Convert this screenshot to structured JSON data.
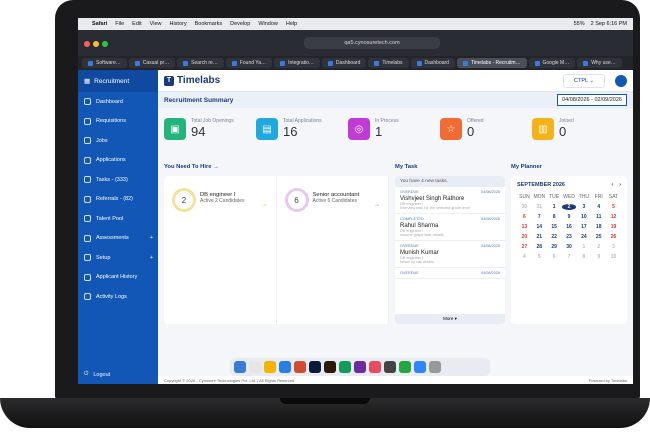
{
  "menubar": {
    "apple": "",
    "app": "Safari",
    "items": [
      "File",
      "Edit",
      "View",
      "History",
      "Bookmarks",
      "Develop",
      "Window",
      "Help"
    ],
    "right": [
      "55%",
      "2 Sep 6:16 PM"
    ]
  },
  "browser": {
    "url": "qa5.cynosuretech.com",
    "tabs": [
      {
        "label": "Software…",
        "active": false
      },
      {
        "label": "Casual pr…",
        "active": false
      },
      {
        "label": "Search re…",
        "active": false
      },
      {
        "label": "Found Ya…",
        "active": false
      },
      {
        "label": "Integratio…",
        "active": false
      },
      {
        "label": "Dashboard",
        "active": false
      },
      {
        "label": "Timelabs",
        "active": false
      },
      {
        "label": "Dashboard",
        "active": false
      },
      {
        "label": "Timelabs - Recruitm…",
        "active": true
      },
      {
        "label": "Google M…",
        "active": false
      },
      {
        "label": "Why use…",
        "active": false
      }
    ]
  },
  "sidebar": {
    "title": "Recruitment",
    "items": [
      {
        "label": "Dashboard"
      },
      {
        "label": "Requisitions"
      },
      {
        "label": "Jobs"
      },
      {
        "label": "Applications"
      },
      {
        "label": "Tasks - (333)"
      },
      {
        "label": "Referrals - (82)"
      },
      {
        "label": "Talent Pool"
      },
      {
        "label": "Assessments",
        "plus": "+"
      },
      {
        "label": "Setup",
        "plus": "+"
      },
      {
        "label": "Applicant History"
      },
      {
        "label": "Activity Logs"
      }
    ],
    "logout": "Logout"
  },
  "header": {
    "logo_text": "Timelabs",
    "org": "CTPL ⌄",
    "summary_title": "Recruitment Summary",
    "date_range": "04/08/2026 - 02/09/2026"
  },
  "stats": [
    {
      "label": "Total Job Openings",
      "value": "94",
      "color": "#22b47a",
      "icon": "briefcase-icon"
    },
    {
      "label": "Total Applications",
      "value": "16",
      "color": "#20a8df",
      "icon": "document-icon"
    },
    {
      "label": "In Process",
      "value": "1",
      "color": "#c03ad6",
      "icon": "user-process-icon"
    },
    {
      "label": "Offered",
      "value": "0",
      "color": "#f26b35",
      "icon": "star-icon"
    },
    {
      "label": "Joined",
      "value": "0",
      "color": "#f3b319",
      "icon": "clipboard-icon"
    }
  ],
  "hire": {
    "title": "You Need To Hire →",
    "items": [
      {
        "count": "2",
        "name": "DB engineer I",
        "sub": "Active 2 Candidates",
        "ring": "#f1e39a"
      },
      {
        "count": "6",
        "name": "Senior accountant",
        "sub": "Active 6 Candidates",
        "ring": "#e8c8ef"
      }
    ]
  },
  "task": {
    "title": "My Task",
    "header": "You have 4 new tasks.",
    "items": [
      {
        "status": "OVERDUE",
        "date": "04/08/2026",
        "name": "Vishvjeet Singh Rathore",
        "role": "DB engineer I",
        "desc": "Interview task for the selected grade level"
      },
      {
        "status": "COMPLETED",
        "date": "04/08/2026",
        "name": "Rahul Sharma",
        "role": "DB engineer I",
        "desc": "resume grape task details"
      },
      {
        "status": "OVERDUE",
        "date": "04/08/2026",
        "name": "Munish Kumar",
        "role": "DB engineer I",
        "desc": "follow up call details"
      },
      {
        "status": "OVERDUE",
        "date": "04/08/2026",
        "name": "",
        "role": "",
        "desc": ""
      }
    ],
    "more": "More ▾"
  },
  "planner": {
    "title": "My Planner",
    "month": "SEPTEMBER 2026",
    "days": [
      "SUN",
      "MON",
      "TUE",
      "WED",
      "THU",
      "FRI",
      "SAT"
    ],
    "cells": [
      "30",
      "31",
      "1",
      "2",
      "3",
      "4",
      "5",
      "6",
      "7",
      "8",
      "9",
      "10",
      "11",
      "12",
      "13",
      "14",
      "15",
      "16",
      "17",
      "18",
      "19",
      "20",
      "21",
      "22",
      "23",
      "24",
      "25",
      "26",
      "27",
      "28",
      "29",
      "30",
      "1",
      "2",
      "3",
      "4",
      "5",
      "6",
      "7",
      "8",
      "9",
      "10"
    ]
  },
  "footer": {
    "left": "Copyright © 2026 - Cynosure Technologies Pvt. Ltd. | All Rights Reserved",
    "right": "Powered by Timelabs"
  }
}
